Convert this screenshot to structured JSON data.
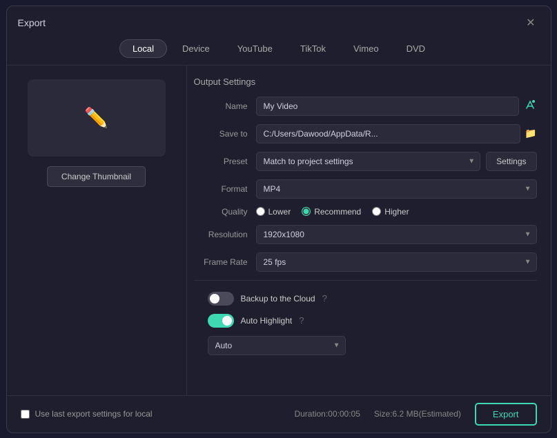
{
  "dialog": {
    "title": "Export",
    "close_label": "✕"
  },
  "tabs": [
    {
      "id": "local",
      "label": "Local",
      "active": true
    },
    {
      "id": "device",
      "label": "Device",
      "active": false
    },
    {
      "id": "youtube",
      "label": "YouTube",
      "active": false
    },
    {
      "id": "tiktok",
      "label": "TikTok",
      "active": false
    },
    {
      "id": "vimeo",
      "label": "Vimeo",
      "active": false
    },
    {
      "id": "dvd",
      "label": "DVD",
      "active": false
    }
  ],
  "thumbnail": {
    "change_label": "Change Thumbnail"
  },
  "output_settings": {
    "section_label": "Output Settings",
    "name_label": "Name",
    "name_value": "My Video",
    "name_placeholder": "My Video",
    "save_to_label": "Save to",
    "save_to_value": "C:/Users/Dawood/AppData/R...",
    "preset_label": "Preset",
    "preset_value": "Match to project settings",
    "settings_label": "Settings",
    "format_label": "Format",
    "format_value": "MP4",
    "quality_label": "Quality",
    "quality_lower": "Lower",
    "quality_recommend": "Recommend",
    "quality_higher": "Higher",
    "resolution_label": "Resolution",
    "resolution_value": "1920x1080",
    "frame_rate_label": "Frame Rate",
    "frame_rate_value": "25 fps"
  },
  "toggles": {
    "backup_label": "Backup to the Cloud",
    "backup_enabled": false,
    "auto_highlight_label": "Auto Highlight",
    "auto_highlight_enabled": true,
    "auto_select_value": "Auto"
  },
  "footer": {
    "checkbox_label": "Use last export settings for local",
    "duration_label": "Duration:00:00:05",
    "size_label": "Size:6.2 MB(Estimated)",
    "export_label": "Export"
  }
}
